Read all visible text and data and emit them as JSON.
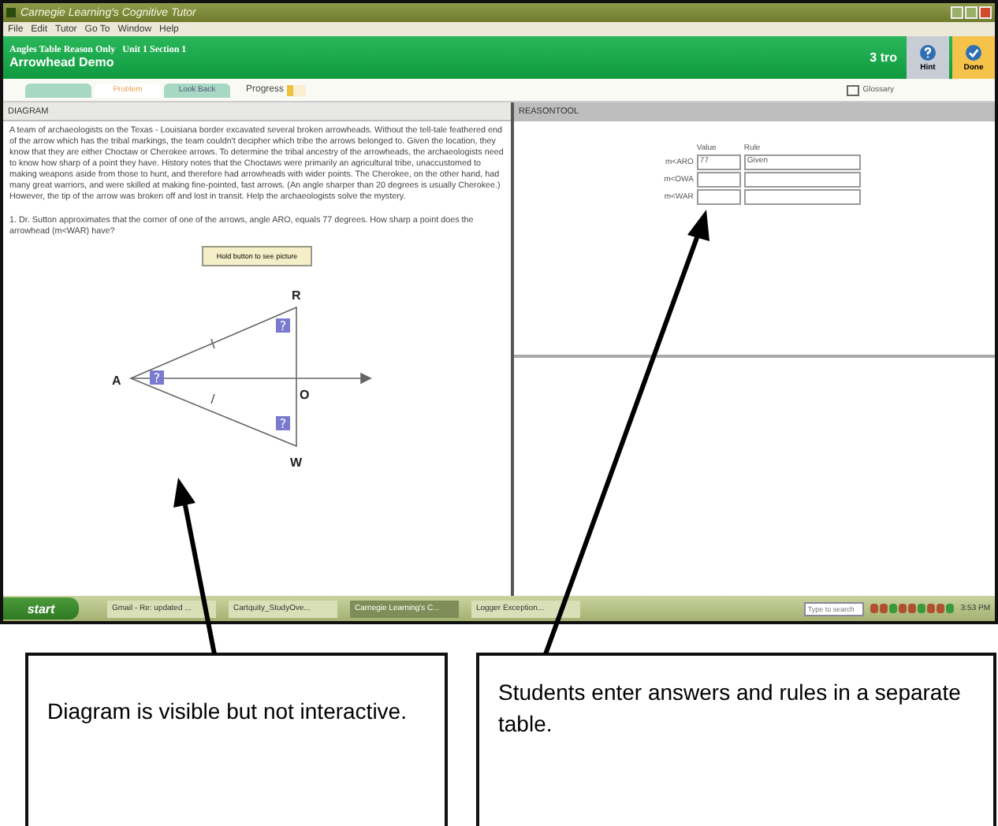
{
  "window": {
    "title": "Carnegie Learning's Cognitive Tutor"
  },
  "menu": [
    "File",
    "Edit",
    "Tutor",
    "Go To",
    "Window",
    "Help"
  ],
  "header": {
    "unit": "Angles Table Reason Only   Unit 1 Section 1",
    "lesson": "Arrowhead Demo",
    "skill": "3 tro",
    "buttons": [
      {
        "label": "Hint",
        "kind": "hint"
      },
      {
        "label": "Done",
        "kind": "done"
      }
    ]
  },
  "tabs": [
    {
      "selected": false
    },
    {
      "label": "Problem",
      "selected": true
    },
    {
      "label": "Look Back",
      "selected": false
    }
  ],
  "progress": {
    "label": "Progress",
    "level": 0.3
  },
  "glossary": "Glossary",
  "diagram": {
    "heading": "DIAGRAM",
    "scenario": "A team of archaeologists on the Texas - Louisiana border excavated several broken arrowheads. Without the tell-tale feathered end of the arrow which has the tribal markings, the team couldn't decipher which tribe the arrows belonged to. Given the location, they know that they are either Choctaw or Cherokee arrows. To determine the tribal ancestry of the arrowheads, the archaeologists need to know how sharp of a point they have. History notes that the Choctaws were primarily an agricultural tribe, unaccustomed to making weapons aside from those to hunt, and therefore had arrowheads with wider points. The Cherokee, on the other hand, had many great warriors, and were skilled at making fine-pointed, fast arrows. (An angle sharper than 20 degrees is usually Cherokee.) However, the tip of the arrow was broken off and lost in transit. Help the archaeologists solve the mystery.",
    "question": "1. Dr. Sutton approximates that the corner of one of the arrows, angle ARO, equals 77 degrees. How sharp a point does the arrowhead (m<WAR) have?",
    "picture_button": "Hold button to see picture",
    "points": [
      "R",
      "A",
      "O",
      "W"
    ],
    "markers": [
      "?",
      "?",
      "?"
    ]
  },
  "reasontool": {
    "heading": "REASONTOOL",
    "columns": [
      "Value",
      "Rule"
    ],
    "rows": [
      {
        "label": "m<ARO",
        "value": "77",
        "rule": "Given"
      },
      {
        "label": "m<OWA"
      },
      {
        "label": "m<WAR"
      }
    ]
  },
  "taskbar": {
    "start": "start",
    "items": [
      {
        "label": "Gmail - Re: updated ...",
        "selected": false
      },
      {
        "label": "Cartquity_StudyOve...",
        "selected": false
      },
      {
        "label": "Carnegie Learning's C...",
        "selected": true
      },
      {
        "label": "Logger Exception...",
        "selected": false
      }
    ],
    "search": {
      "placeholder": "Type to search"
    },
    "clock": "3:53 PM"
  },
  "callouts": [
    "Diagram is visible but not interactive.",
    "Students enter answers and rules in a separate table."
  ]
}
